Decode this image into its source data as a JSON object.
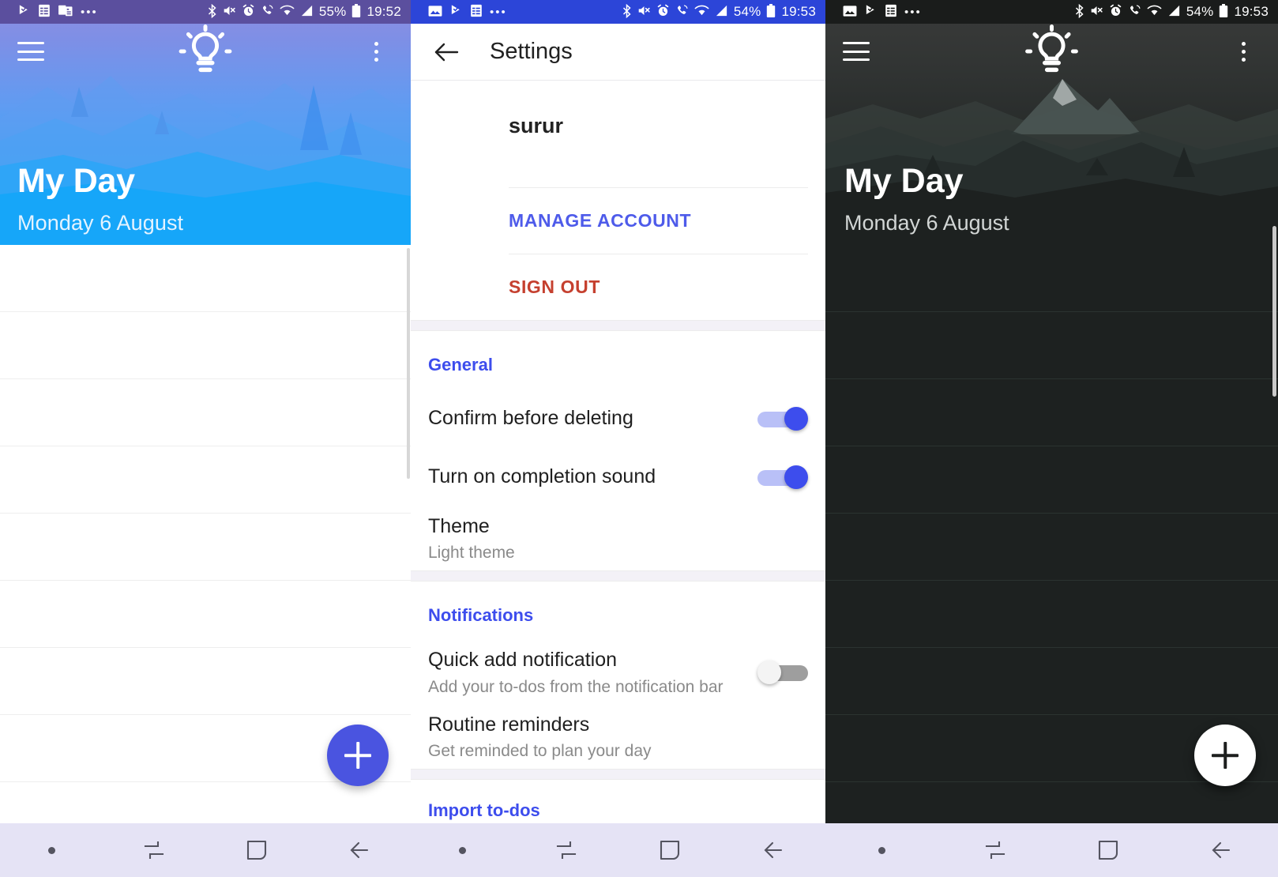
{
  "left_phone": {
    "statusbar": {
      "left_icons": [
        "play-store-icon",
        "spreadsheet-icon",
        "news-icon"
      ],
      "overflow": "•••",
      "right_icons": [
        "bluetooth-icon",
        "mute-icon",
        "alarm-icon",
        "call-icon",
        "wifi-icon",
        "signal-icon"
      ],
      "battery_percent": "55%",
      "clock": "19:52"
    },
    "appbar": {
      "menu_icon": "hamburger-icon",
      "theme_icon": "lightbulb-icon",
      "overflow_icon": "kebab-icon"
    },
    "hero": {
      "title": "My Day",
      "subtitle": "Monday 6 August"
    },
    "fab_label": "+",
    "navbar": {
      "items": [
        "dot",
        "recents",
        "home",
        "back"
      ]
    }
  },
  "settings_phone": {
    "statusbar": {
      "left_icons": [
        "image-icon",
        "play-store-icon",
        "spreadsheet-icon"
      ],
      "overflow": "•••",
      "right_icons": [
        "bluetooth-icon",
        "mute-icon",
        "alarm-icon",
        "call-icon",
        "wifi-icon",
        "signal-icon"
      ],
      "battery_percent": "54%",
      "clock": "19:53"
    },
    "appbar": {
      "back_icon": "back-arrow-icon",
      "title": "Settings"
    },
    "account": {
      "name": "surur",
      "manage_label": "MANAGE ACCOUNT",
      "signout_label": "SIGN OUT",
      "manage_color": "#4e5bea",
      "signout_color": "#c5402f"
    },
    "sections": [
      {
        "heading": "General",
        "heading_color": "#3d4ded",
        "rows": [
          {
            "title": "Confirm before deleting",
            "subtitle": "",
            "control": "switch",
            "state": "on"
          },
          {
            "title": "Turn on completion sound",
            "subtitle": "",
            "control": "switch",
            "state": "on"
          },
          {
            "title": "Theme",
            "subtitle": "Light theme",
            "control": "none",
            "state": ""
          }
        ]
      },
      {
        "heading": "Notifications",
        "heading_color": "#3d4ded",
        "rows": [
          {
            "title": "Quick add notification",
            "subtitle": "Add your to-dos from the notification bar",
            "control": "switch",
            "state": "off"
          },
          {
            "title": "Routine reminders",
            "subtitle": "Get reminded to plan your day",
            "control": "none",
            "state": ""
          }
        ]
      },
      {
        "heading": "Import to-dos",
        "heading_color": "#3d4ded",
        "rows": []
      }
    ],
    "navbar": {
      "items": [
        "dot",
        "recents",
        "home",
        "back"
      ]
    }
  },
  "right_phone": {
    "statusbar": {
      "left_icons": [
        "image-icon",
        "play-store-icon",
        "spreadsheet-icon"
      ],
      "overflow": "•••",
      "right_icons": [
        "bluetooth-icon",
        "mute-icon",
        "alarm-icon",
        "call-icon",
        "wifi-icon",
        "signal-icon"
      ],
      "battery_percent": "54%",
      "clock": "19:53"
    },
    "appbar": {
      "menu_icon": "hamburger-icon",
      "theme_icon": "lightbulb-icon",
      "overflow_icon": "kebab-icon"
    },
    "hero": {
      "title": "My Day",
      "subtitle": "Monday 6 August"
    },
    "fab_label": "+",
    "navbar": {
      "items": [
        "dot",
        "recents",
        "home",
        "back"
      ]
    }
  },
  "colors": {
    "accent_blue": "#3d4ded",
    "fab_blue": "#4a54e0",
    "status_purple": "#5b4f9e",
    "status_blue": "#2c45d8",
    "status_dark": "#1a1c1b",
    "navbar_bg": "#e5e3f5",
    "dark_bg": "#1d2120"
  }
}
